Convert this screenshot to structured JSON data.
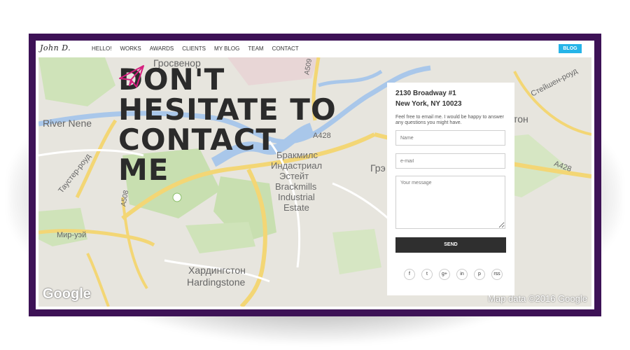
{
  "nav": {
    "logo": "John D.",
    "items": [
      "HELLO!",
      "WORKS",
      "AWARDS",
      "CLIENTS",
      "MY BLOG",
      "TEAM",
      "CONTACT"
    ],
    "blog_label": "BLOG",
    "blog_color": "#26b4e8"
  },
  "hero": {
    "lines": [
      "DON'T",
      "HESITATE TO",
      "CONTACT",
      "ME"
    ]
  },
  "map": {
    "labels": [
      "Гросвенор",
      "River Nene",
      "A428",
      "A509",
      "Таустер-роуд",
      "A508",
      "Мир-уэй",
      "Хардингстон",
      "Hardingstone",
      "Бракмилс",
      "Индастриал",
      "Эстейт",
      "Brackmills",
      "Industrial",
      "Estate",
      "Стейшен-роуд",
      "A428",
      "Грэ",
      "тон"
    ],
    "google": "Google",
    "attribution": "Map data ©2016 Google"
  },
  "contact": {
    "address_line1": "2130 Broadway #1",
    "address_line2": "New York, NY 10023",
    "note": "Feel free to email me. I would be happy to answer any questions you might have.",
    "name_placeholder": "Name",
    "email_placeholder": "e-mail",
    "message_placeholder": "Your message",
    "send_label": "SEND",
    "social_icons": [
      "facebook-icon",
      "twitter-icon",
      "google-plus-icon",
      "linkedin-icon",
      "pinterest-icon",
      "rss-icon"
    ],
    "social_glyphs": [
      "f",
      "t",
      "g+",
      "in",
      "p",
      "rss"
    ]
  },
  "colors": {
    "frame": "#3d1256",
    "accent": "#d5207f",
    "button_dark": "#2f2f2f"
  }
}
